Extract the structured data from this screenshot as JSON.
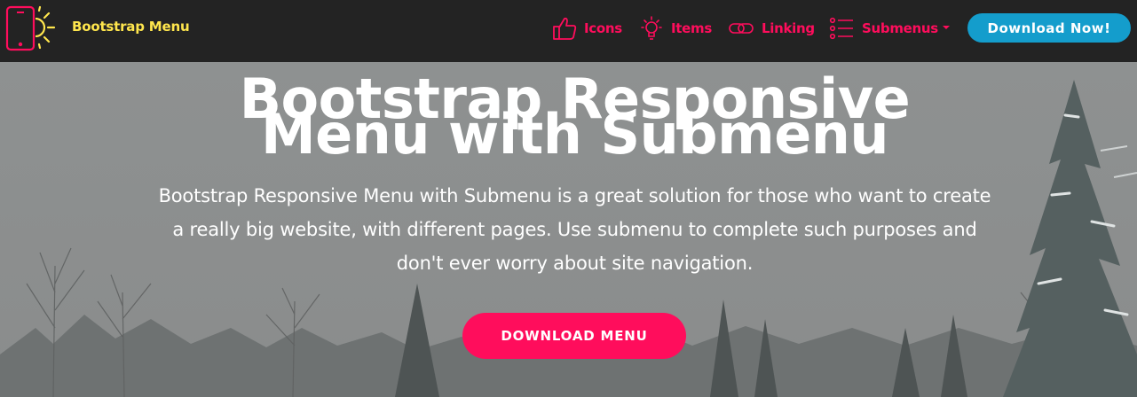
{
  "brand": {
    "name": "Bootstrap Menu",
    "logo_icon": "mobile-sun-icon"
  },
  "nav": {
    "items": [
      {
        "label": "Icons",
        "icon": "thumbs-up-icon"
      },
      {
        "label": "Items",
        "icon": "lightbulb-icon"
      },
      {
        "label": "Linking",
        "icon": "link-icon"
      },
      {
        "label": "Submenus",
        "icon": "list-icon",
        "has_dropdown": true
      }
    ],
    "download_label": "Download Now!"
  },
  "hero": {
    "title_line1": "Bootstrap Responsive",
    "title_line2": "Menu with Submenu",
    "description": "Bootstrap Responsive Menu with Submenu is a great solution for those who want to create a really big website, with different pages. Use submenu to complete such purposes and don't ever worry about site navigation.",
    "button_label": "DOWNLOAD MENU"
  },
  "colors": {
    "navbar_bg": "#232323",
    "brand_text": "#ffe64d",
    "accent": "#ff0d5c",
    "download_button": "#149dcc",
    "hero_text": "#ffffff"
  }
}
